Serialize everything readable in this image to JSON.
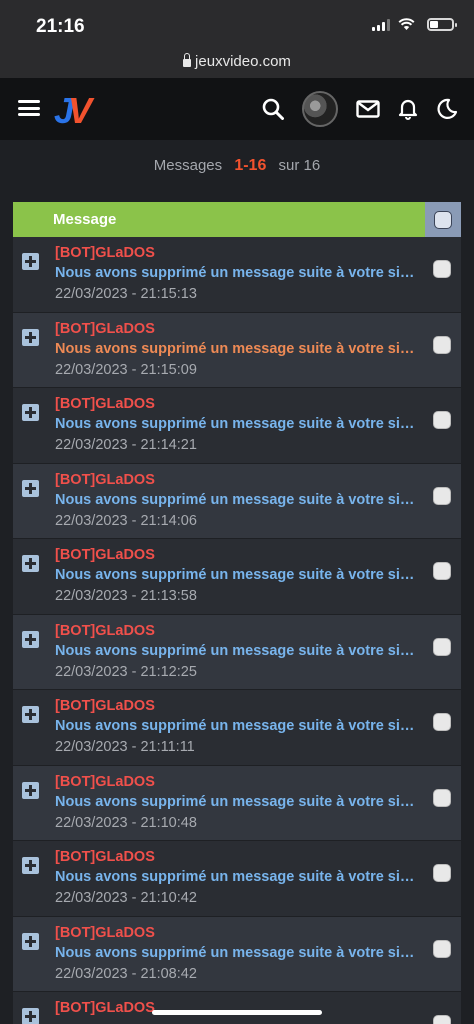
{
  "status": {
    "time": "21:16"
  },
  "browser": {
    "url": "jeuxvideo.com"
  },
  "header": {
    "logo_j": "J",
    "logo_v": "V"
  },
  "pager": {
    "prefix": "Messages",
    "range": "1-16",
    "suffix": "sur 16"
  },
  "table": {
    "column_label": "Message"
  },
  "messages": [
    {
      "author": "[BOT]GLaDOS",
      "subject": "Nous avons supprimé un message suite à votre signalement",
      "date": "22/03/2023 - 21:15:13"
    },
    {
      "author": "[BOT]GLaDOS",
      "subject": "Nous avons supprimé un message suite à votre signalement",
      "date": "22/03/2023 - 21:15:09"
    },
    {
      "author": "[BOT]GLaDOS",
      "subject": "Nous avons supprimé un message suite à votre signalement",
      "date": "22/03/2023 - 21:14:21"
    },
    {
      "author": "[BOT]GLaDOS",
      "subject": "Nous avons supprimé un message suite à votre signalement",
      "date": "22/03/2023 - 21:14:06"
    },
    {
      "author": "[BOT]GLaDOS",
      "subject": "Nous avons supprimé un message suite à votre signalement",
      "date": "22/03/2023 - 21:13:58"
    },
    {
      "author": "[BOT]GLaDOS",
      "subject": "Nous avons supprimé un message suite à votre signalement",
      "date": "22/03/2023 - 21:12:25"
    },
    {
      "author": "[BOT]GLaDOS",
      "subject": "Nous avons supprimé un message suite à votre signalement",
      "date": "22/03/2023 - 21:11:11"
    },
    {
      "author": "[BOT]GLaDOS",
      "subject": "Nous avons supprimé un message suite à votre signalement",
      "date": "22/03/2023 - 21:10:48"
    },
    {
      "author": "[BOT]GLaDOS",
      "subject": "Nous avons supprimé un message suite à votre signalement",
      "date": "22/03/2023 - 21:10:42"
    },
    {
      "author": "[BOT]GLaDOS",
      "subject": "Nous avons supprimé un message suite à votre signalement",
      "date": "22/03/2023 - 21:08:42"
    },
    {
      "author": "[BOT]GLaDOS",
      "subject": "",
      "date": ""
    }
  ],
  "colors": {
    "accent": "#f2522e",
    "header_green": "#8bc34a",
    "author": "#f0504b",
    "link": "#78b4ec",
    "visited": "#ee8a55"
  }
}
